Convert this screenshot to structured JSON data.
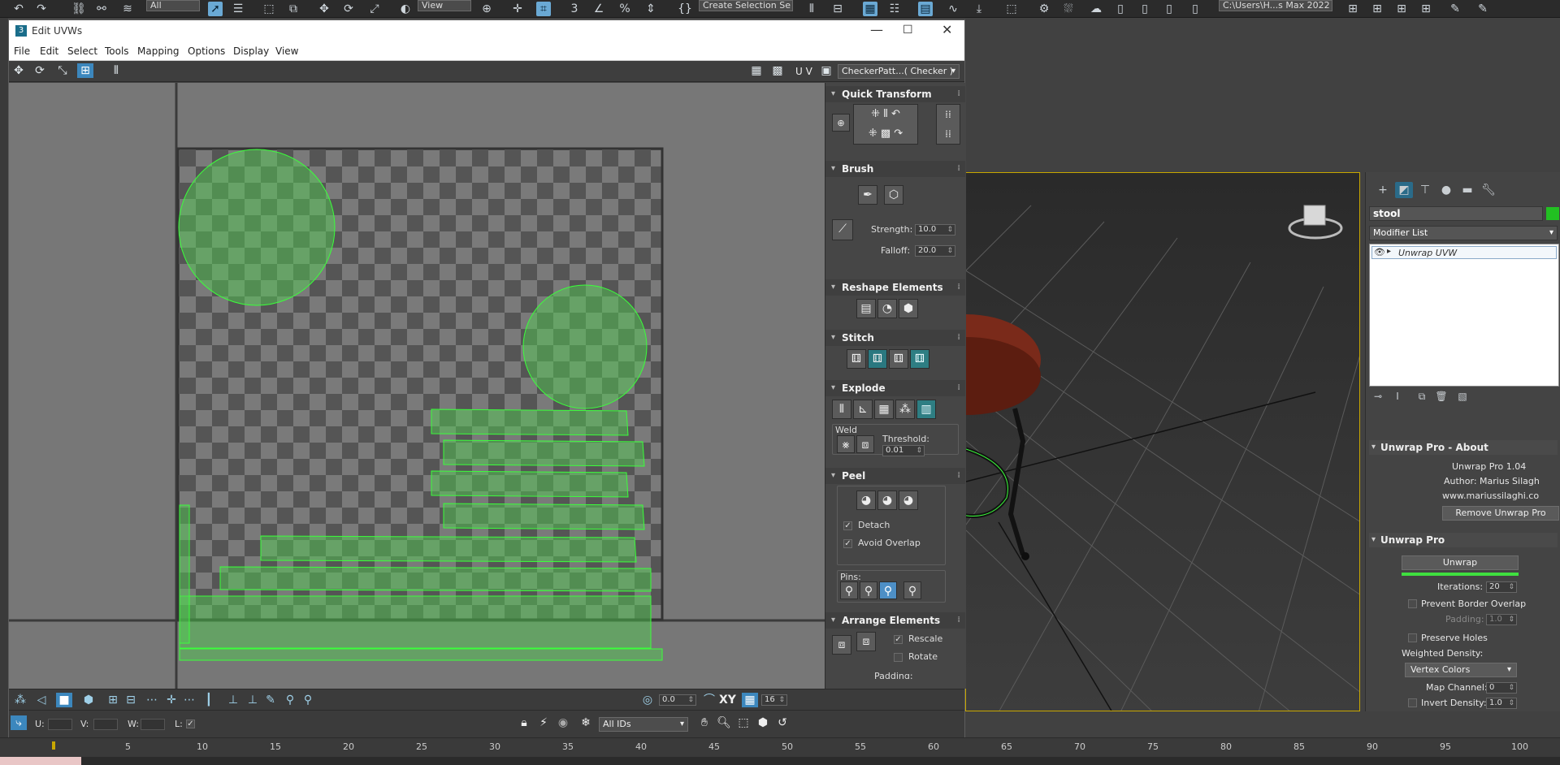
{
  "toolbar": {
    "selection_filter": "All",
    "view_dropdown": "View",
    "selection_set": "Create Selection Se",
    "project_path": "C:\\Users\\H...s Max 2022"
  },
  "uvw_window": {
    "title": "Edit UVWs",
    "menu": [
      "File",
      "Edit",
      "Select",
      "Tools",
      "Mapping",
      "Options",
      "Display",
      "View"
    ],
    "uv_label": "U V",
    "texture_dropdown": "CheckerPatt...( Checker )",
    "sections": {
      "quick_transform": "Quick Transform",
      "brush": "Brush",
      "reshape": "Reshape Elements",
      "stitch": "Stitch",
      "explode": "Explode",
      "peel": "Peel",
      "arrange": "Arrange Elements"
    },
    "brush": {
      "strength_label": "Strength:",
      "strength": "10.0",
      "falloff_label": "Falloff:",
      "falloff": "20.0"
    },
    "explode": {
      "weld_label": "Weld",
      "threshold_label": "Threshold:",
      "threshold": "0.01"
    },
    "peel": {
      "detach_label": "Detach",
      "detach": true,
      "avoid_label": "Avoid Overlap",
      "avoid": true,
      "pins_label": "Pins:"
    },
    "arrange": {
      "rescale_label": "Rescale",
      "rescale": true,
      "rotate_label": "Rotate",
      "rotate": false,
      "padding_label": "Padding:"
    },
    "bottom": {
      "value1": "0.0",
      "xy_label": "XY",
      "grid_value": "16",
      "u_label": "U:",
      "v_label": "V:",
      "w_label": "W:",
      "l_label": "L:",
      "ids_dropdown": "All IDs"
    }
  },
  "command_panel": {
    "object_name": "stool",
    "object_color": "#22c022",
    "modifier_list": "Modifier List",
    "modifier_stack_item": "Unwrap UVW",
    "about_title": "Unwrap Pro - About",
    "about_version": "Unwrap Pro 1.04",
    "about_author": "Author: Marius Silagh",
    "about_site": "www.mariussilaghi.co",
    "remove_btn": "Remove Unwrap Pro",
    "pro_title": "Unwrap Pro",
    "unwrap_btn": "Unwrap",
    "iterations_label": "Iterations:",
    "iterations": "20",
    "prevent_border_label": "Prevent Border Overlap",
    "padding_label": "Padding:",
    "padding": "1.0",
    "preserve_holes_label": "Preserve Holes",
    "weighted_density_label": "Weighted Density:",
    "vertex_colors": "Vertex Colors",
    "map_channel_label": "Map Channel:",
    "map_channel": "0",
    "invert_density_label": "Invert Density:",
    "invert_density": "1.0"
  },
  "timeline": {
    "ticks": [
      "5",
      "10",
      "15",
      "20",
      "25",
      "30",
      "35",
      "40",
      "45",
      "50",
      "55",
      "60",
      "65",
      "70",
      "75",
      "80",
      "85",
      "90",
      "95",
      "100"
    ]
  },
  "colors": {
    "uv_green": "#3bff3b",
    "viewport_border": "#c8a700",
    "stool_seat": "#7a2a1a",
    "accent_teal": "#2e7e83"
  }
}
